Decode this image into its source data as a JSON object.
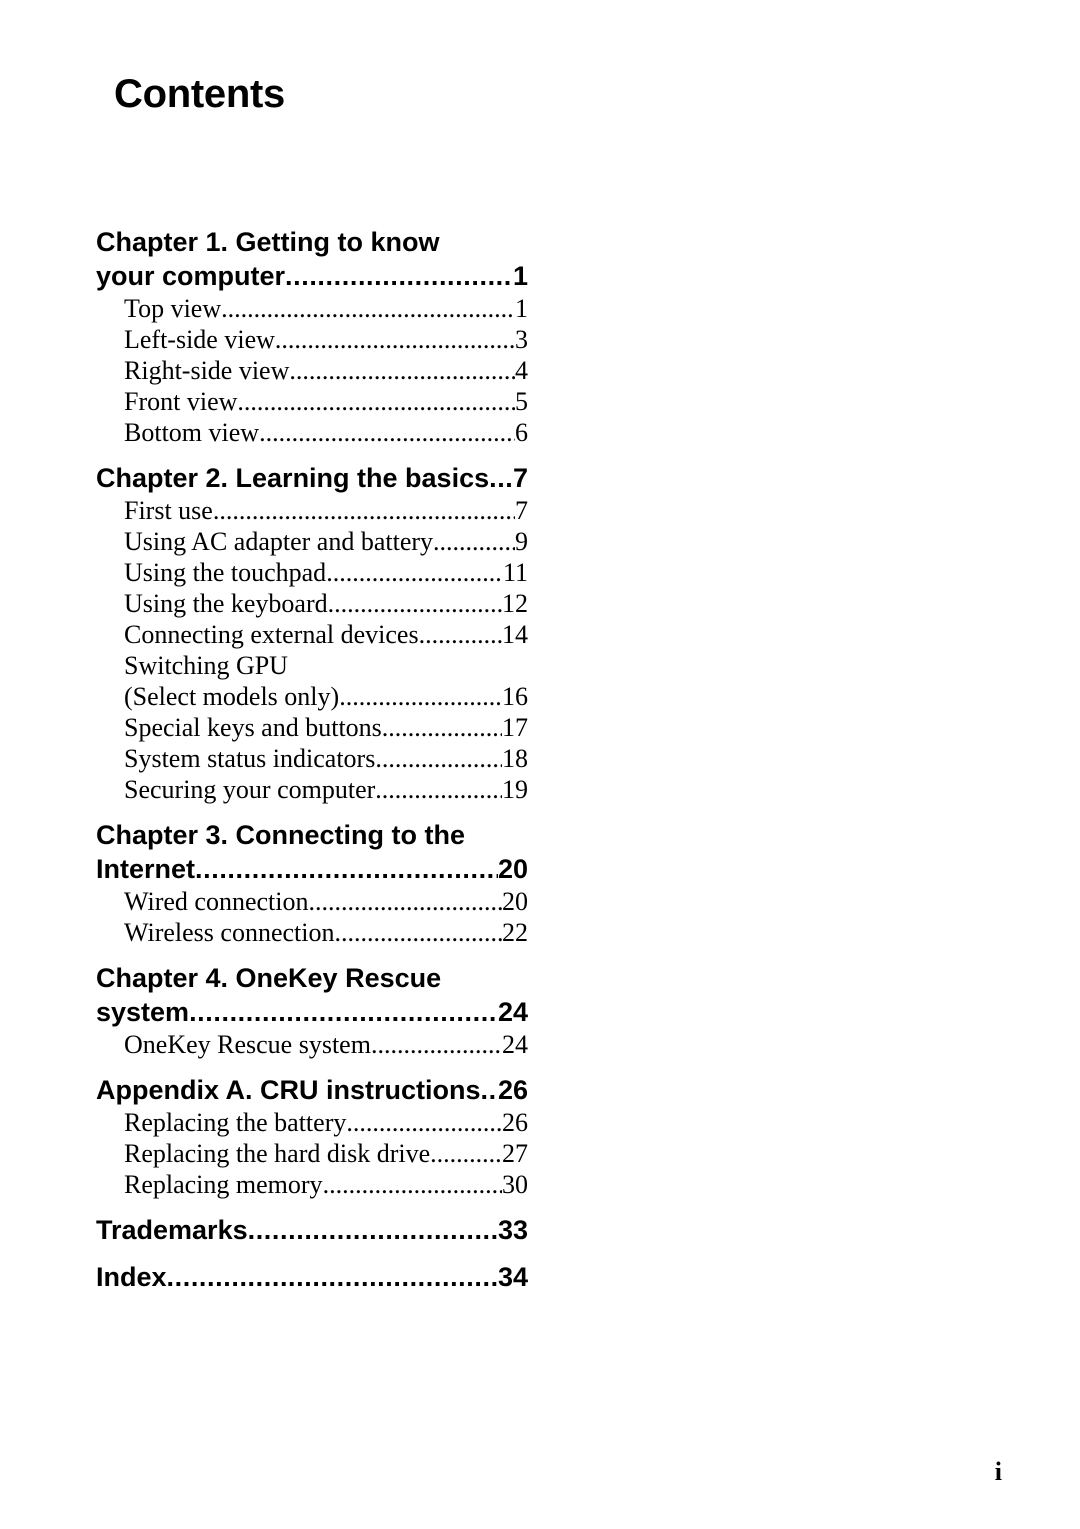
{
  "page": {
    "title": "Contents",
    "folio": "i",
    "background_color": "#ffffff",
    "text_color": "#000000"
  },
  "toc": {
    "sections": [
      {
        "kind": "chapter",
        "wrapped": true,
        "line1": "Chapter 1. Getting to know",
        "label": "your computer",
        "page": "1",
        "entries": [
          {
            "label": "Top view",
            "page": "1"
          },
          {
            "label": "Left-side view",
            "page": "3"
          },
          {
            "label": "Right-side view",
            "page": "4"
          },
          {
            "label": "Front view",
            "page": "5"
          },
          {
            "label": "Bottom view",
            "page": "6"
          }
        ]
      },
      {
        "kind": "chapter",
        "wrapped": false,
        "label": "Chapter 2. Learning the basics",
        "page": "7",
        "entries": [
          {
            "label": "First use",
            "page": "7"
          },
          {
            "label": "Using AC adapter and battery",
            "page": "9"
          },
          {
            "label": "Using the touchpad",
            "page": "11"
          },
          {
            "label": "Using the keyboard",
            "page": "12"
          },
          {
            "label": "Connecting external devices",
            "page": "14"
          },
          {
            "wrapped": true,
            "line1": "Switching GPU",
            "label": "(Select models only)",
            "page": "16"
          },
          {
            "label": "Special keys and buttons",
            "page": "17"
          },
          {
            "label": "System status indicators",
            "page": "18"
          },
          {
            "label": "Securing your computer",
            "page": "19"
          }
        ]
      },
      {
        "kind": "chapter",
        "wrapped": true,
        "line1": "Chapter 3. Connecting to the",
        "label": "Internet",
        "page": "20",
        "entries": [
          {
            "label": "Wired connection",
            "page": "20"
          },
          {
            "label": "Wireless connection",
            "page": "22"
          }
        ]
      },
      {
        "kind": "chapter",
        "wrapped": true,
        "line1": "Chapter 4. OneKey Rescue",
        "label": "system",
        "page": "24",
        "entries": [
          {
            "label": "OneKey Rescue system",
            "page": "24"
          }
        ]
      },
      {
        "kind": "appendix",
        "wrapped": false,
        "label": "Appendix A. CRU instructions",
        "page": "26",
        "entries": [
          {
            "label": "Replacing the battery",
            "page": "26"
          },
          {
            "label": "Replacing the hard disk drive",
            "page": "27"
          },
          {
            "label": "Replacing memory",
            "page": "30"
          }
        ]
      },
      {
        "kind": "backmatter",
        "wrapped": false,
        "label": "Trademarks",
        "page": "33",
        "entries": []
      },
      {
        "kind": "backmatter",
        "wrapped": false,
        "label": "Index",
        "page": "34",
        "entries": []
      }
    ]
  }
}
